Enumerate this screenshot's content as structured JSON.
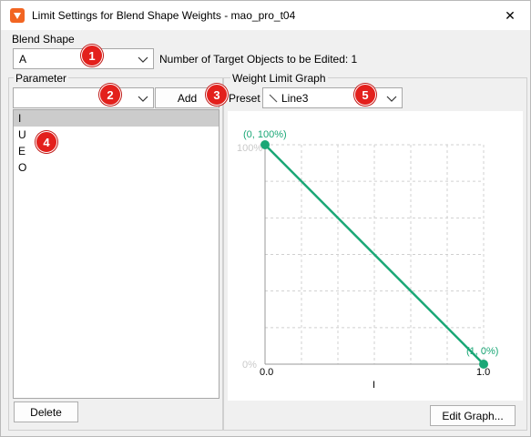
{
  "window": {
    "title": "Limit Settings for Blend Shape Weights - mao_pro_t04",
    "close_glyph": "✕"
  },
  "blend_shape": {
    "group_label": "Blend Shape",
    "selected": "A",
    "target_count_text": "Number of Target Objects to be Edited: 1"
  },
  "parameter": {
    "group_label": "Parameter",
    "combo_value": "",
    "add_label": "Add",
    "items": [
      "I",
      "U",
      "E",
      "O"
    ],
    "selected_index": 0,
    "delete_label": "Delete"
  },
  "graph": {
    "group_label": "Weight Limit Graph",
    "preset_label": "Preset",
    "preset_value": "Line3",
    "point_start_label": "(0, 100%)",
    "point_end_label": "(1, 0%)",
    "y_top_label": "100%",
    "y_bottom_label": "0%",
    "x_left_label": "0.0",
    "x_right_label": "1.0",
    "x_axis_label": "I",
    "edit_label": "Edit Graph...",
    "line_color": "#1aa776",
    "grid_color": "#d0d0d0"
  },
  "chart_data": {
    "type": "line",
    "x": [
      0,
      1
    ],
    "y": [
      100,
      0
    ],
    "xlim": [
      0,
      1
    ],
    "ylim": [
      0,
      100
    ],
    "xlabel": "I",
    "grid": true
  },
  "annotations": [
    "1",
    "2",
    "3",
    "4",
    "5"
  ],
  "colors": {
    "accent": "#1aa776",
    "badge": "#e3201c",
    "app_icon": "#f26522"
  }
}
